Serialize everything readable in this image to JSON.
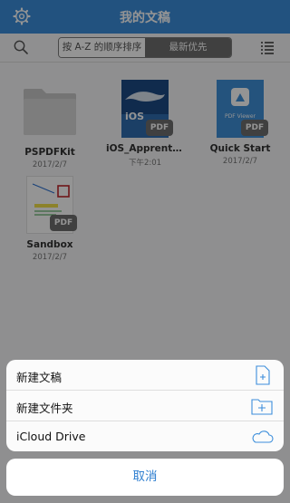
{
  "navbar": {
    "title": "我的文稿",
    "settings_icon": "gear-icon"
  },
  "toolbar": {
    "sort_options": [
      "按 A-Z 的顺序排序",
      "最新优先"
    ],
    "selected_sort": "最新优先",
    "search_icon": "search-icon",
    "view_icon": "list-view-icon"
  },
  "documents": [
    {
      "name": "PSPDFKit",
      "date": "2017/2/7",
      "kind": "folder"
    },
    {
      "name": "iOS_Apprenti...",
      "date": "下午2:01",
      "kind": "pdf",
      "badge": "PDF",
      "cover_text": "iOS"
    },
    {
      "name": "Quick Start",
      "date": "2017/2/7",
      "kind": "pdf",
      "badge": "PDF",
      "cover_text": "PDF Viewer"
    },
    {
      "name": "Sandbox",
      "date": "2017/2/7",
      "kind": "pdf",
      "badge": "PDF"
    }
  ],
  "action_sheet": {
    "items": [
      {
        "label": "新建文稿",
        "icon": "new-document-icon"
      },
      {
        "label": "新建文件夹",
        "icon": "new-folder-icon"
      },
      {
        "label": "iCloud Drive",
        "icon": "cloud-icon"
      }
    ],
    "cancel_label": "取消"
  },
  "colors": {
    "accent": "#3c8edb",
    "link": "#2f7fd0",
    "badge": "#6e6e6e"
  }
}
